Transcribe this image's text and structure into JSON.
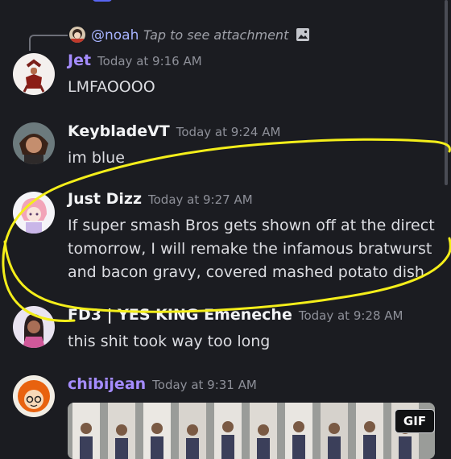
{
  "reply": {
    "username": "@noah",
    "text": "Tap to see attachment"
  },
  "messages": [
    {
      "username": "Jet",
      "timestamp": "Today at 9:16 AM",
      "body": [
        "LMFAOOOO"
      ]
    },
    {
      "username": "KeybladeVT",
      "timestamp": "Today at 9:24 AM",
      "body": [
        "im blue"
      ]
    },
    {
      "username": "Just Dizz",
      "timestamp": "Today at 9:27 AM",
      "body": [
        "If super smash Bros gets shown off at the direct",
        "tomorrow, I will remake the infamous bratwurst",
        "and bacon gravy, covered mashed potato dish"
      ]
    },
    {
      "username": "FD3 | YES KING Emeneche",
      "timestamp": "Today at 9:28 AM",
      "body": [
        "this shit took way too long"
      ]
    },
    {
      "username": "chibijean",
      "timestamp": "Today at 9:31 AM",
      "body": []
    }
  ],
  "attachment": {
    "badge": "GIF"
  },
  "colors": {
    "background": "#1b1c21",
    "accent": "#5865f2",
    "mention": "#a7b3ff",
    "purple_username": "#a58cff",
    "annotation": "#f4ee1a"
  },
  "icons": {
    "reply": "reply-connector-icon",
    "attachment": "image-icon"
  }
}
